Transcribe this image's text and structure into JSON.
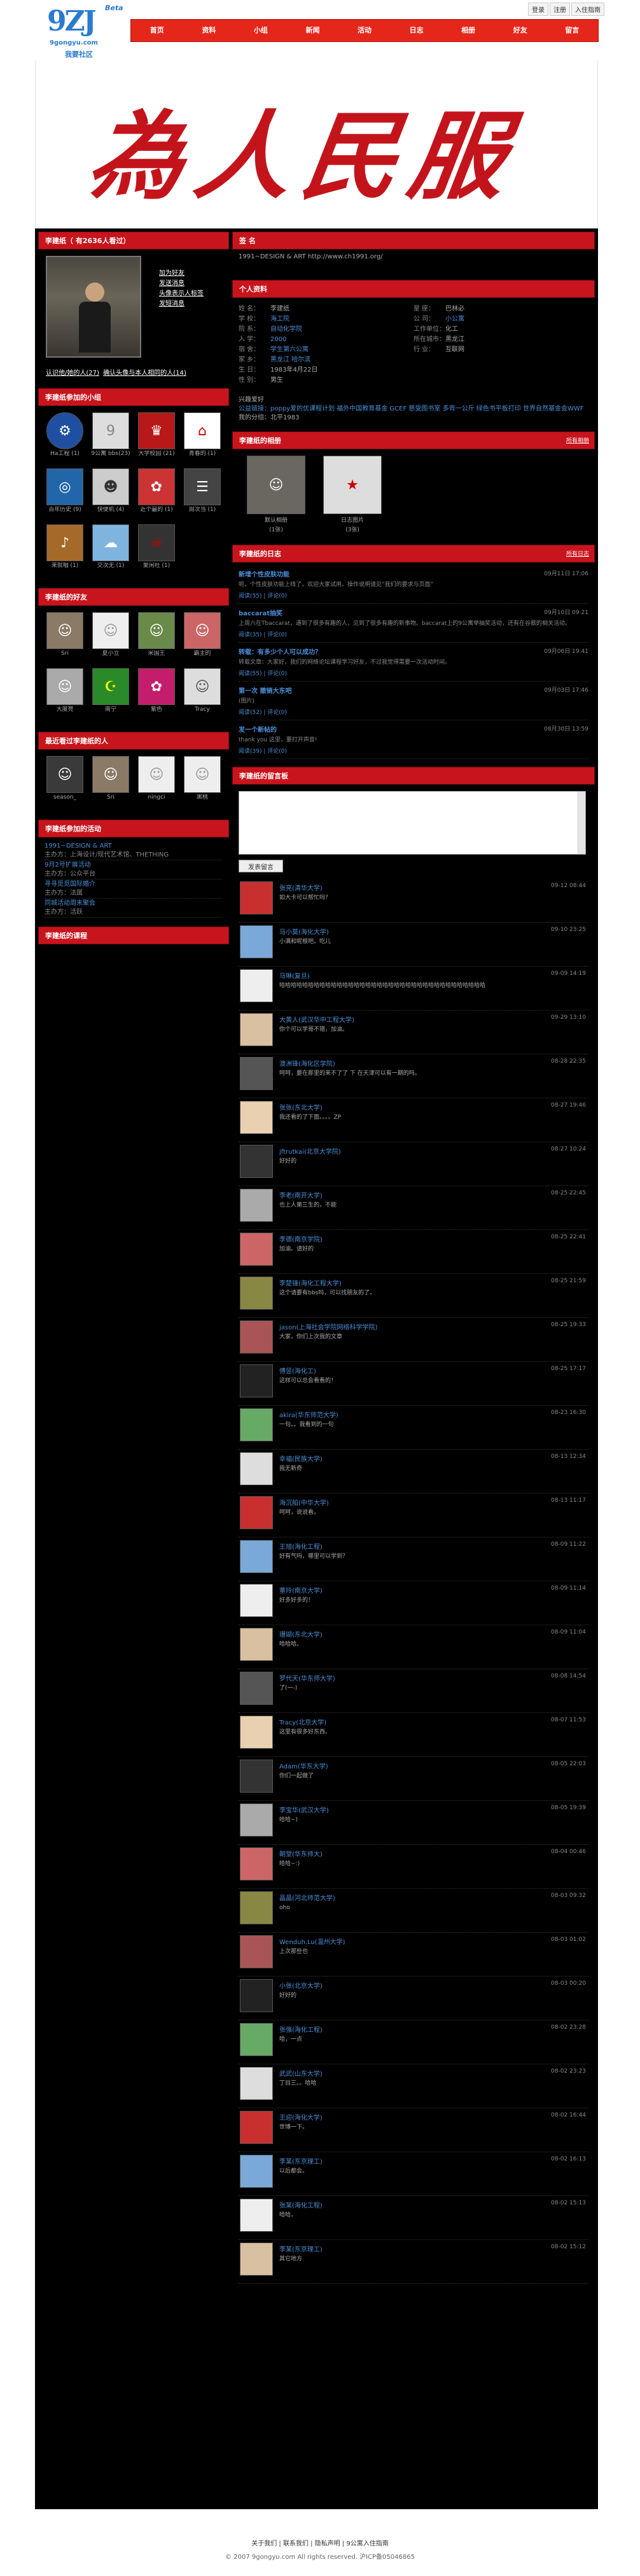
{
  "brand": {
    "logo": "9ZJ",
    "beta": "Beta",
    "url": "9gongyu.com",
    "sub": "我要社区",
    "banner": "為人民服務"
  },
  "toplinks": [
    "登录",
    "注册",
    "入住指南"
  ],
  "nav": [
    "首页",
    "资料",
    "小组",
    "新闻",
    "活动",
    "日志",
    "相册",
    "好友",
    "留言"
  ],
  "profile": {
    "name": "李建纸（ 有2636人看过）",
    "links": [
      "加为好友",
      "发送消息",
      "头像表示人标签",
      "发短消息"
    ],
    "stats_a": "认识他/她的人(27)",
    "stats_b": "确认头像与本人相同的人(14)"
  },
  "groups": {
    "title": "李建纸参加的小组",
    "items": [
      "Ha工程 (1)",
      "9公寓 bbs(23)",
      "大学校园 (21)",
      "青春的 (1)",
      "百年历史 (9)",
      "快便机 (4)",
      "近个最的 (1)",
      "周次当 (1)",
      "来就唱 (1)",
      "交次无 (1)",
      "爱闲社 (1)"
    ]
  },
  "friends": {
    "title": "李建纸的好友",
    "items": [
      "Sri",
      "夏小立",
      "米国王",
      "霸主的",
      "大度亮",
      "南宁",
      "紫色",
      "Tracy"
    ]
  },
  "visitors": {
    "title": "最近看过李建纸的人",
    "items": [
      "season_",
      "Sri",
      "ningci",
      "黑桃"
    ]
  },
  "activities": {
    "title": "李建纸参加的活动",
    "items": [
      {
        "t": "1991~DESIGN & ART",
        "s": "主办方：上海设计/现代艺术馆、THETHING"
      },
      {
        "t": "9月2号扩展活动",
        "s": "主办方：公众平台"
      },
      {
        "t": "寻寻觅觅国际婚介",
        "s": "主办方：法属"
      },
      {
        "t": "同城活动周末聚会",
        "s": "主办方：活跃"
      }
    ]
  },
  "courses": {
    "title": "李建纸的课程"
  },
  "signature": {
    "title": "签 名",
    "text": "1991~DESIGN & ART http://www.ch1991.org/"
  },
  "info": {
    "title": "个人资料",
    "left": [
      [
        "姓  名：",
        "李建纸"
      ],
      [
        "学  校：",
        "海工院"
      ],
      [
        "院  系：",
        "自动化学院"
      ],
      [
        "入  学：",
        "2000"
      ],
      [
        "宿  舍：",
        "学生第六公寓"
      ],
      [
        "家  乡：",
        "黑龙江 哈尔滨"
      ],
      [
        "生  日：",
        "1983年4月22日"
      ],
      [
        "性  别：",
        "男生"
      ]
    ],
    "right": [
      [
        "星  座：",
        "巴林必"
      ],
      [
        "公  司：",
        "小公寓"
      ],
      [
        "工作单位：",
        "化工"
      ],
      [
        "所在城市：",
        "黑龙江"
      ],
      [
        "行  业：",
        "互联网"
      ]
    ]
  },
  "interest": {
    "line1": "兴趣爱好",
    "line2": "公益链接：poppy爱的优课程计划 福外中国教育基金 GCEF 慈受图书室 多背一公斤 绿色书平板打印 世界自然基金会WWF",
    "line3": "我的分组：北平1983"
  },
  "albums": {
    "title": "李建纸的相册",
    "more": "所有相册",
    "items": [
      "默认相册",
      "(1张)"
    ],
    "items2": [
      "日志图片",
      "(3张)"
    ]
  },
  "blog": {
    "title": "李建纸的日志",
    "more": "所有日志",
    "posts": [
      {
        "t": "新增个性皮肤功能",
        "d": "09月11日 17:06",
        "s": "呃，个性皮肤功能上线了，欢迎大家试用。操作说明请见“我们的要求与页面”",
        "m": "阅读(55) | 评论(0)"
      },
      {
        "t": "baccarat抽奖",
        "d": "09月10日 09:21",
        "s": "上周六在Tbaccarat，遇到了很多有趣的人，见到了很多有趣的新事物。baccarat上的9公寓举抽奖活动，还有在谷歌的相关活动。",
        "m": "阅读(35) | 评论(0)"
      },
      {
        "t": "转载：有多少个人可以成功？",
        "d": "09月06日 19:41",
        "s": "转载文章：大家好，我们的网络论坛课程学习好友，不过我觉得需要一次活动时间。",
        "m": "阅读(55) | 评论(0)"
      },
      {
        "t": "第一次 撤销大东吧",
        "d": "09月03日 17:46",
        "s": "(图片)",
        "m": "阅读(52) | 评论(0)"
      },
      {
        "t": "发一个新帖的",
        "d": "08月30日 13:59",
        "s": "thank you 这里，要打开声音!",
        "m": "阅读(39) | 评论(0)"
      }
    ]
  },
  "guestbook": {
    "title": "李建纸的留言板",
    "button": "发表留言",
    "entries": [
      {
        "n": "张亮(清华大学)",
        "d": "09-12 08:44",
        "c": "如大卡可以帮忙吗？"
      },
      {
        "n": "马小莫(海化大学)",
        "d": "09-10 23:25",
        "c": "小满和呢根吧。吃儿"
      },
      {
        "n": "马琳(复旦)",
        "d": "09-09 14:19",
        "c": "哈哈哈哈哈哈哈哈哈哈哈哈哈哈哈哈哈哈哈哈哈哈哈哈哈哈哈哈哈哈哈哈哈哈哈哈"
      },
      {
        "n": "大黄人(武汉华中工程大学)",
        "d": "09-29 13:10",
        "c": "你个可以学哥不错，加油。"
      },
      {
        "n": "澳洲锋(海化区学院)",
        "d": "08-28 22:35",
        "c": "呵呵，要在那里的来不了了 下 在天津可以有一期的吗。"
      },
      {
        "n": "张张(东北大学)",
        "d": "08-27 19:46",
        "c": "我还看的了下面。。。。ZP"
      },
      {
        "n": "jftrutkai(北京大学院)",
        "d": "08-27 10:24",
        "c": "好好的"
      },
      {
        "n": "李老(南开大学)",
        "d": "08-25 22:45",
        "c": "也上人第三生的，不能"
      },
      {
        "n": "李德(南京学院)",
        "d": "08-25 22:41",
        "c": "加油。请好的"
      },
      {
        "n": "李楚锋(海化工程大学)",
        "d": "08-25 21:59",
        "c": "这个请要有bbs吗，可以找朋友的了。"
      },
      {
        "n": "jason(上海社会学院网络科学学院)",
        "d": "08-25 19:33",
        "c": "大家，你们上次我的文章"
      },
      {
        "n": "傅昱(海化工)",
        "d": "08-25 17:17",
        "c": "这样可以总会看看的！"
      },
      {
        "n": "akira(华东师范大学)",
        "d": "08-23 16:30",
        "c": "一句。。我看到的一句"
      },
      {
        "n": "幸福(民族大学)",
        "d": "08-13 12:34",
        "c": "我无新奇"
      },
      {
        "n": "海沉船(中华大学)",
        "d": "08-13 11:17",
        "c": "呵呵，说说看。"
      },
      {
        "n": "王旭(海化工程)",
        "d": "08-09 11:22",
        "c": "好有气吗，哪里可以学到？"
      },
      {
        "n": "董玲(南京大学)",
        "d": "08-09 11:14",
        "c": "好多好多的！"
      },
      {
        "n": "珊瑚(东北大学)",
        "d": "08-09 11:04",
        "c": "哈哈哈。"
      },
      {
        "n": "罗代天(华东师大学)",
        "d": "08-08 14:54",
        "c": "了(一-)"
      },
      {
        "n": "Tracy(北京大学)",
        "d": "08-07 11:53",
        "c": "这里有很多好东西。"
      },
      {
        "n": "Adam(华东大学)",
        "d": "08-05 22:03",
        "c": "你们一起做了"
      },
      {
        "n": "李宝华(武汉大学)",
        "d": "08-05 19:39",
        "c": "哈哈~)"
      },
      {
        "n": "朝堂(华东师大)",
        "d": "08-04 00:46",
        "c": "哈哈~:)"
      },
      {
        "n": "晶晶(河北师范大学)",
        "d": "08-03 09:32",
        "c": "oho"
      },
      {
        "n": "Wenduh.Lu(温州大学)",
        "d": "08-03 01:02",
        "c": "上次那些也"
      },
      {
        "n": "小张(北京大学)",
        "d": "08-03 00:20",
        "c": "好好的"
      },
      {
        "n": "张强(海化工程)",
        "d": "08-02 23:28",
        "c": "哈，一点"
      },
      {
        "n": "武武(山东大学)",
        "d": "08-02 23:23",
        "c": "丁目三。。哈哈"
      },
      {
        "n": "王迎(海化大学)",
        "d": "08-02 16:44",
        "c": "世博一下。"
      },
      {
        "n": "李某(东京理工)",
        "d": "08-02 16:13",
        "c": "以后都会。"
      },
      {
        "n": "张某(海化工程)",
        "d": "08-02 15:13",
        "c": "哈哈，"
      },
      {
        "n": "李某(东京理工)",
        "d": "08-02 15:12",
        "c": "其它地方"
      }
    ]
  },
  "footer": {
    "links": "关于我们 | 联系我们 | 隐私声明 | 9公寓入住指南",
    "copy": "© 2007 9gongyu.com All rights reserved. 沪ICP备05046865"
  }
}
